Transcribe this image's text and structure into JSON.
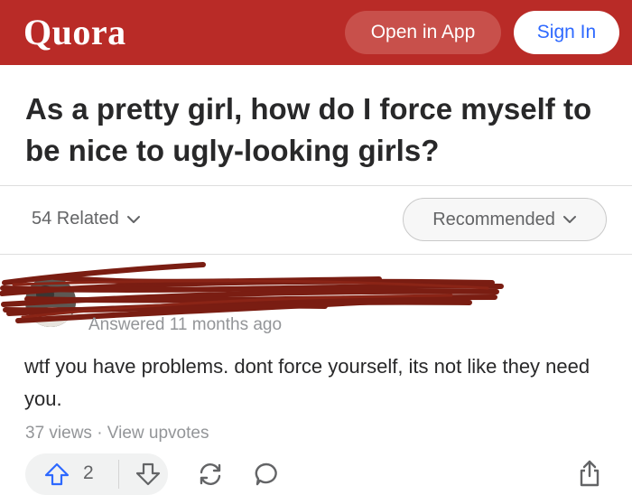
{
  "header": {
    "logo": "Quora",
    "open_in_app": "Open in App",
    "sign_in": "Sign In",
    "brand_color": "#b92b27"
  },
  "question": {
    "title": "As a pretty girl, how do I force myself to be nice to ugly-looking girls?"
  },
  "related": {
    "label": "54 Related",
    "sort_label": "Recommended"
  },
  "answer": {
    "meta": "Answered 11 months ago",
    "text": "wtf you have problems. dont force yourself, its not like they need you.",
    "views": "37 views · View upvotes",
    "upvote_count": "2"
  },
  "icons": {
    "related_chevron": "chevron-down-icon",
    "sort_chevron": "chevron-down-icon",
    "upvote": "arrow-up-icon",
    "downvote": "arrow-down-icon",
    "share": "refresh-share-icon",
    "comment": "comment-bubble-icon",
    "upload": "share-upload-icon"
  }
}
